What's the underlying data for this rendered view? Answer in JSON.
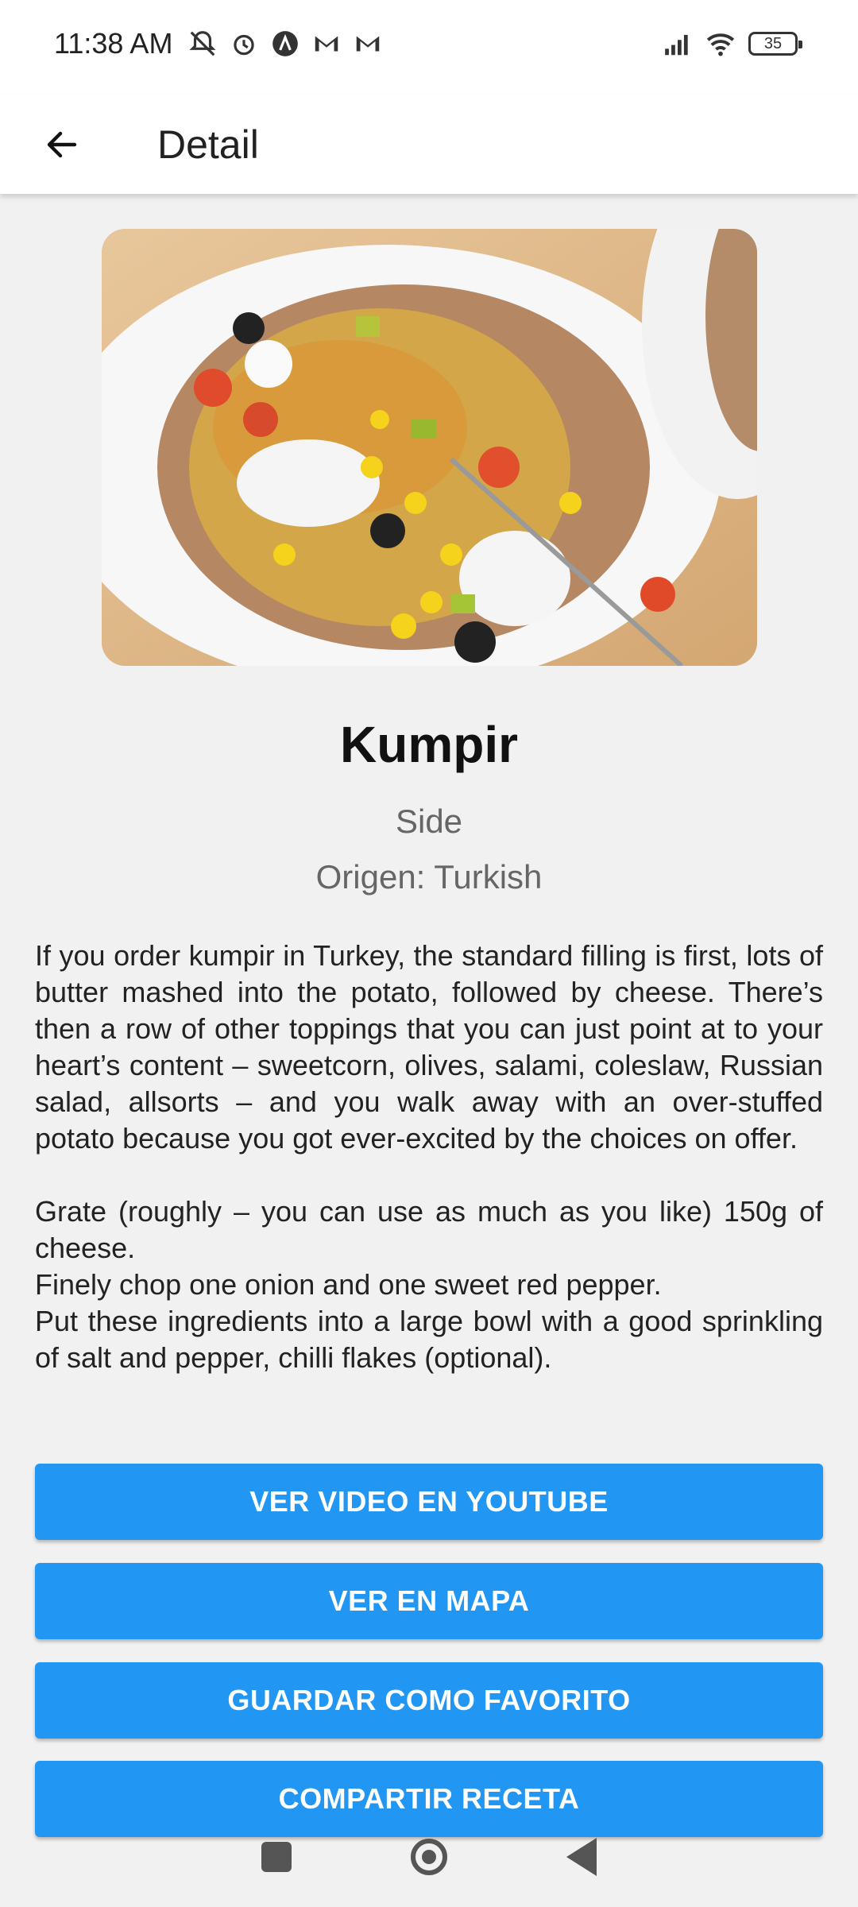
{
  "status_bar": {
    "time": "11:38 AM",
    "battery": "35",
    "icons_left": [
      "mute-icon",
      "alarm-icon",
      "app-icon",
      "gmail-icon",
      "gmail-icon"
    ],
    "icons_right": [
      "signal-icon",
      "wifi-icon",
      "battery-icon"
    ]
  },
  "app_bar": {
    "title": "Detail",
    "back_icon": "arrow-left-icon"
  },
  "recipe": {
    "image_alt": "Kumpir photo",
    "title": "Kumpir",
    "category": "Side",
    "origin": "Origen: Turkish",
    "description_paragraphs": [
      "If you order kumpir in Turkey, the standard filling is first, lots of butter mashed into the potato, followed by cheese. There’s then a row of other toppings that you can just point at to your heart’s content – sweetcorn, olives, salami, coleslaw, Russian salad, allsorts – and you walk away with an over-stuffed potato because you got ever-excited by the choices on offer.",
      "Grate (roughly – you can use as much as you like) 150g of cheese.\nFinely chop one onion and one sweet red pepper.\nPut these ingredients into a large bowl with a good sprinkling of salt and pepper, chilli flakes (optional)."
    ]
  },
  "buttons": {
    "youtube": "VER VIDEO EN YOUTUBE",
    "map": "VER EN MAPA",
    "favorite": "GUARDAR COMO FAVORITO",
    "share": "COMPARTIR RECETA"
  },
  "colors": {
    "accent": "#2196f3",
    "background": "#f1f1f1"
  }
}
